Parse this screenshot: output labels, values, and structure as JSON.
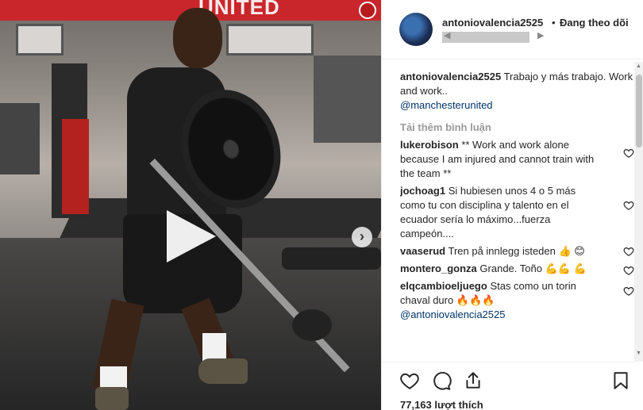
{
  "media": {
    "banner_text": "UNITED",
    "next_symbol": "›"
  },
  "header": {
    "username": "antoniovalencia2525",
    "dot": "•",
    "follow_label": "Đang theo dõi",
    "location_prev": "◀",
    "location_next": "▶"
  },
  "caption": {
    "username": "antoniovalencia2525",
    "text": "Trabajo y más trabajo. Work and work..",
    "mention": "@manchesterunited"
  },
  "load_more": "Tải thêm bình luận",
  "comments": [
    {
      "username": "lukerobison",
      "text": "** Work and work alone because I am injured and cannot train with the team **",
      "emoji": "",
      "mention": ""
    },
    {
      "username": "jochoag1",
      "text": "Si hubiesen unos 4 o 5 más como tu con disciplina y talento en el ecuador sería lo máximo...fuerza campeón....",
      "emoji": "",
      "mention": ""
    },
    {
      "username": "vaaserud",
      "text": "Tren på innlegg isteden",
      "emoji": "👍 😊",
      "mention": ""
    },
    {
      "username": "montero_gonza",
      "text": "Grande. Toño",
      "emoji": "💪💪 💪",
      "mention": ""
    },
    {
      "username": "elqcambioeljuego",
      "text": "Stas como un torin chaval duro",
      "emoji": "🔥🔥🔥",
      "mention": "@antoniovalencia2525"
    }
  ],
  "likes": "77,163 lượt thích",
  "icons": {
    "like": "heart-icon",
    "comment": "comment-icon",
    "share": "share-icon",
    "save": "bookmark-icon"
  }
}
